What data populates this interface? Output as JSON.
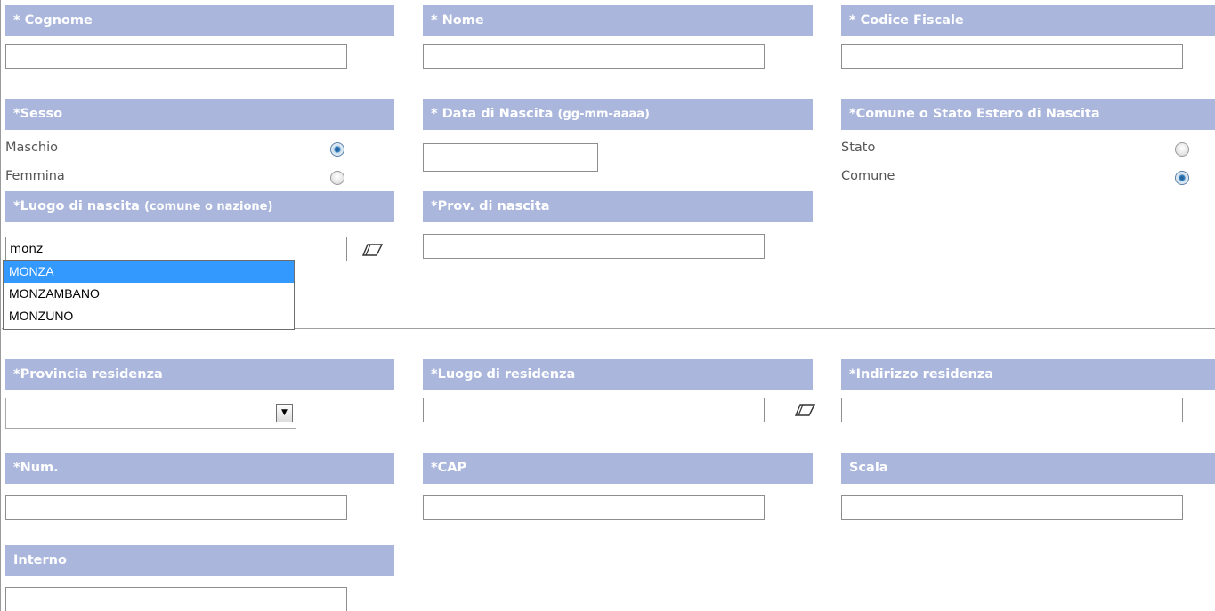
{
  "fields": {
    "cognome": {
      "label": "* Cognome",
      "value": ""
    },
    "nome": {
      "label": "* Nome",
      "value": ""
    },
    "codice_fiscale": {
      "label": "* Codice Fiscale",
      "value": ""
    },
    "sesso": {
      "label": "*Sesso",
      "options": [
        {
          "label": "Maschio",
          "selected": true
        },
        {
          "label": "Femmina",
          "selected": false
        }
      ]
    },
    "data_nascita": {
      "label": "* Data di Nascita",
      "label_note": "(gg-mm-aaaa)",
      "value": ""
    },
    "comune_stato": {
      "label": "*Comune o Stato Estero di Nascita",
      "options": [
        {
          "label": "Stato",
          "selected": false
        },
        {
          "label": "Comune",
          "selected": true
        }
      ]
    },
    "luogo_nascita": {
      "label": "*Luogo di nascita",
      "label_note": "(comune o nazione)",
      "value": "monz",
      "suggestions": [
        "MONZA",
        "MONZAMBANO",
        "MONZUNO"
      ],
      "selected_suggestion": "MONZA"
    },
    "prov_nascita": {
      "label": "*Prov. di nascita",
      "value": ""
    },
    "provincia_residenza": {
      "label": "*Provincia residenza",
      "value": ""
    },
    "luogo_residenza": {
      "label": "*Luogo di residenza",
      "value": ""
    },
    "indirizzo_residenza": {
      "label": "*Indirizzo residenza",
      "value": ""
    },
    "num": {
      "label": "*Num.",
      "value": ""
    },
    "cap": {
      "label": "*CAP",
      "value": ""
    },
    "scala": {
      "label": "Scala",
      "value": ""
    },
    "interno": {
      "label": "Interno",
      "value": ""
    }
  },
  "icons": {
    "clear": "eraser-icon",
    "dropdown": "chevron-down-icon"
  },
  "colors": {
    "header_bg": "#aab6dc",
    "header_text": "#ffffff",
    "highlight": "#3399ff",
    "radio_on": "#2e77b6"
  }
}
